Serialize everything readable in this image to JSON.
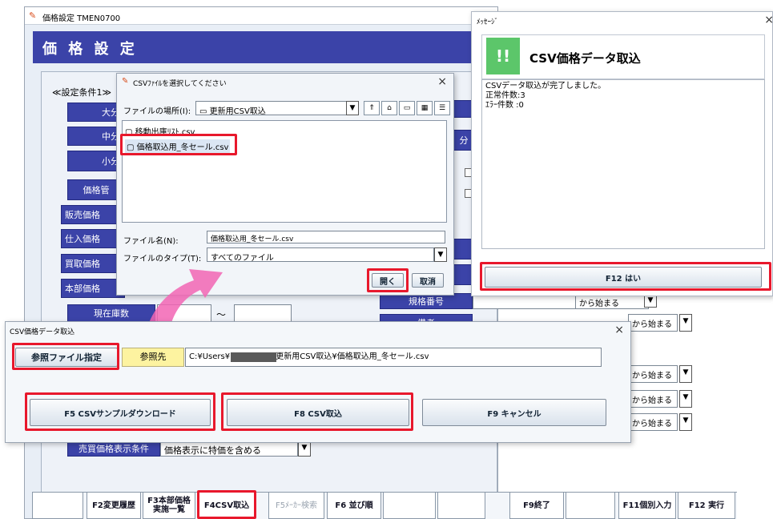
{
  "main": {
    "title_bar": "価格設定  TMEN0700",
    "header": "価 格 設 定",
    "cond_title": "≪設定条件1≫",
    "btns": [
      "大分",
      "中分",
      "小分",
      "価格管",
      "販売価格",
      "仕入価格",
      "買取価格",
      "本部価格"
    ],
    "zaiko": "現在庫数",
    "tilde": "〜",
    "right_label": "分",
    "kikaku": "規格番号",
    "bikou": "備考",
    "starts": [
      "から始まる",
      "から始まる",
      "から始まる",
      "から始まる",
      "から始まる"
    ],
    "baika": "売買価格表示条件",
    "baika_val": "価格表示に特価を含める"
  },
  "fkeys": [
    "F2変更履歴",
    "F3本部価格実施一覧",
    "F4CSV取込",
    "F5ﾒｰｶｰ検索",
    "F6 並び順",
    "F9終了",
    "F11個別入力",
    "F12 実行"
  ],
  "msg": {
    "title": "ﾒｯｾｰｼﾞ",
    "icon": "!!",
    "heading": "CSV価格データ取込",
    "lines": [
      "CSVデータ取込が完了しました。",
      "正常件数:3",
      "ｴﾗｰ件数 :0"
    ],
    "ok": "F12  はい"
  },
  "file": {
    "title": "CSVﾌｧｲﾙを選択してください",
    "loc_label": "ファイルの場所(I):",
    "loc_val": "更新用CSV取込",
    "files": [
      "移動出庫ﾘｽﾄ.csv",
      "価格取込用_冬セール.csv"
    ],
    "name_label": "ファイル名(N):",
    "name_val": "価格取込用_冬セール.csv",
    "type_label": "ファイルのタイプ(T):",
    "type_val": "すべてのファイル",
    "open": "開く",
    "cancel": "取消"
  },
  "csv": {
    "title": "CSV価格データ取込",
    "ref_btn": "参照ファイル指定",
    "ref_label": "参照先",
    "path": "C:¥Users¥            ¥Desktop¥更新用CSV取込¥価格取込用_冬セール.csv",
    "sample": "F5 CSVサンプルダウンロード",
    "import": "F8 CSV取込",
    "cancel": "F9  キャンセル"
  },
  "colors": {
    "navy": "#3b43a8",
    "accent_red": "#e8182c",
    "green": "#5cc66a",
    "pink": "#f265b4"
  }
}
